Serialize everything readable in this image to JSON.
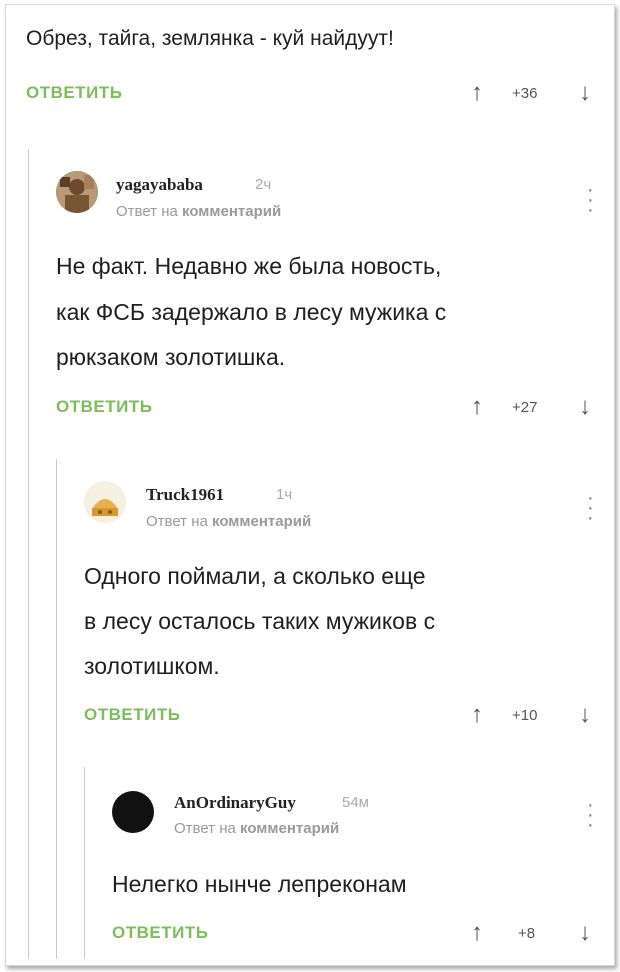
{
  "root": {
    "text": "Обрез, тайга, землянка - куй найдуут!",
    "reply": "ОТВЕТИТЬ",
    "votes": "+36"
  },
  "comments": [
    {
      "username": "yagayababa",
      "time": "2ч",
      "meta_prefix": "Ответ на",
      "meta_link": "комментарий",
      "lines": [
        "Не факт. Недавно же была новость,",
        "как ФСБ задержало в лесу мужика с",
        "рюкзаком золотишка."
      ],
      "reply": "ОТВЕТИТЬ",
      "votes": "+27"
    },
    {
      "username": "Truck1961",
      "time": "1ч",
      "meta_prefix": "Ответ на",
      "meta_link": "комментарий",
      "lines": [
        "Одного поймали, а сколько еще",
        "в лесу осталось таких мужиков с",
        "золотишком."
      ],
      "reply": "ОТВЕТИТЬ",
      "votes": "+10"
    },
    {
      "username": "AnOrdinaryGuy",
      "time": "54м",
      "meta_prefix": "Ответ на",
      "meta_link": "комментарий",
      "lines": [
        "Нелегко нынче лепреконам"
      ],
      "reply": "ОТВЕТИТЬ",
      "votes": "+8"
    }
  ],
  "icons": {
    "upvote": "arrow-up-icon",
    "downvote": "arrow-down-icon",
    "more": "more-vertical-icon"
  },
  "colors": {
    "reply_green": "#7cbf5a",
    "meta_gray": "#9a9a9a"
  }
}
